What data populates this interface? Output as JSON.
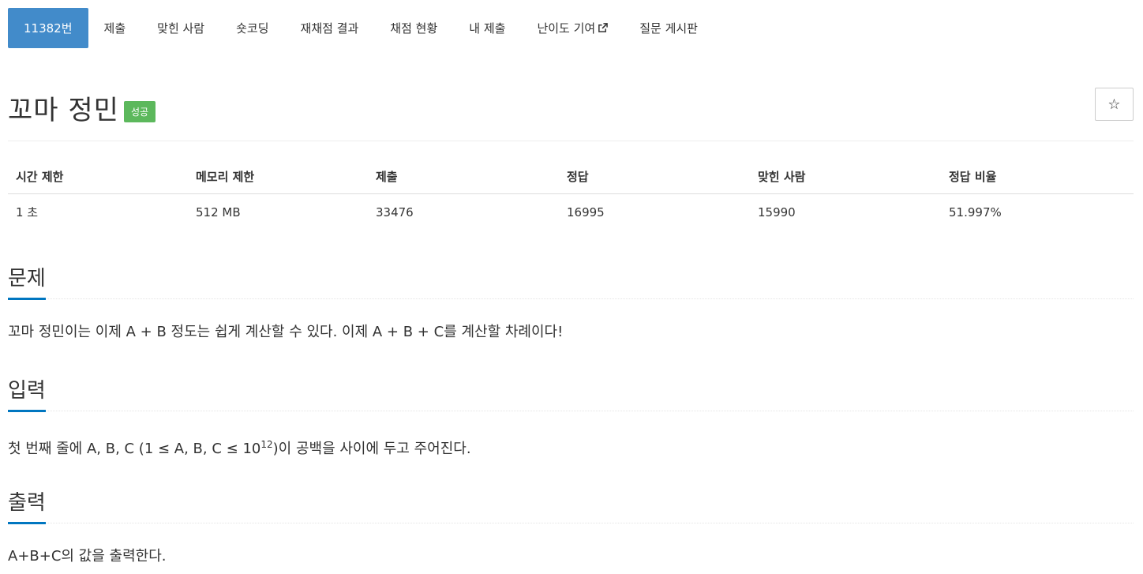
{
  "nav": {
    "items": [
      {
        "label": "11382번"
      },
      {
        "label": "제출"
      },
      {
        "label": "맞힌 사람"
      },
      {
        "label": "숏코딩"
      },
      {
        "label": "재채점 결과"
      },
      {
        "label": "채점 현황"
      },
      {
        "label": "내 제출"
      },
      {
        "label": "난이도 기여",
        "icon": "external-link-icon"
      },
      {
        "label": "질문 게시판"
      }
    ],
    "active_color": "#428bca"
  },
  "problem": {
    "title": "꼬마 정민",
    "status_badge": "성공",
    "badge_color": "#5cb85c",
    "star_icon": "☆"
  },
  "info_table": {
    "headers": [
      "시간 제한",
      "메모리 제한",
      "제출",
      "정답",
      "맞힌 사람",
      "정답 비율"
    ],
    "values": [
      "1 초",
      "512 MB",
      "33476",
      "16995",
      "15990",
      "51.997%"
    ]
  },
  "sections": {
    "description": {
      "heading": "문제",
      "text": "꼬마 정민이는 이제 A + B 정도는 쉽게 계산할 수 있다. 이제 A + B + C를 계산할 차례이다!"
    },
    "input": {
      "heading": "입력",
      "text_before": "첫 번째 줄에 A, B, C (1 ≤ A, B, C ≤ 10",
      "sup": "12",
      "text_after": ")이 공백을 사이에 두고 주어진다."
    },
    "output": {
      "heading": "출력",
      "text": "A+B+C의 값을 출력한다."
    }
  }
}
